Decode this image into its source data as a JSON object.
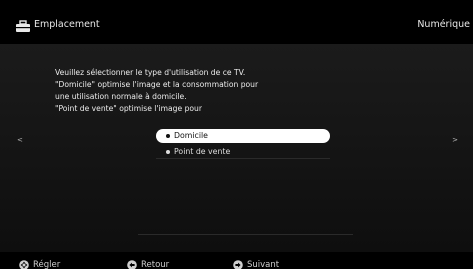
{
  "header": {
    "title": "Emplacement",
    "right_label": "Numérique",
    "icon": "toolbox-icon"
  },
  "description": {
    "lines": [
      "Veuillez sélectionner le type d'utilisation de ce TV.",
      "\"Domicile\" optimise l'image et la consommation pour",
      "une utilisation normale à domicile.",
      "\"Point de vente\" optimise l'image pour"
    ]
  },
  "nav": {
    "left_arrow": "<",
    "right_arrow": ">"
  },
  "options": [
    {
      "label": "Domicile",
      "selected": true
    },
    {
      "label": "Point de vente",
      "selected": false
    }
  ],
  "footer": {
    "hints": [
      {
        "icon": "dpad-icon",
        "label": "Régler"
      },
      {
        "icon": "return-icon",
        "label": "Retour"
      },
      {
        "icon": "next-icon",
        "label": "Suivant"
      }
    ]
  },
  "colors": {
    "background": "#050505",
    "selected_bg": "#ffffff",
    "text": "#ececec"
  }
}
